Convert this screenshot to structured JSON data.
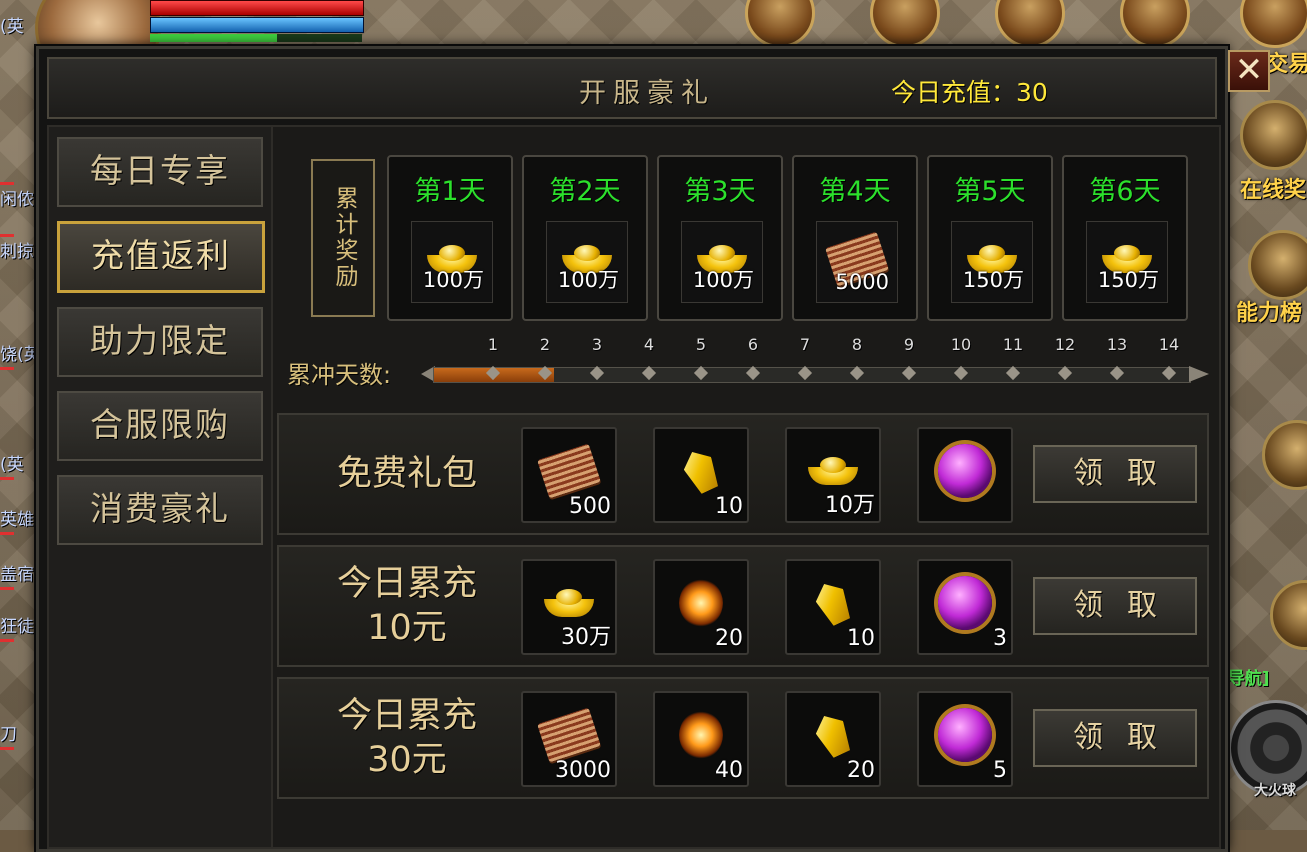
{
  "window": {
    "title": "开服豪礼",
    "recharge_today": "今日充值：30",
    "close_label": "✕"
  },
  "sidebar": {
    "tabs": [
      {
        "label": "每日专享",
        "active": false
      },
      {
        "label": "充值返利",
        "active": true
      },
      {
        "label": "助力限定",
        "active": false
      },
      {
        "label": "合服限购",
        "active": false
      },
      {
        "label": "消费豪礼",
        "active": false
      }
    ]
  },
  "cumulative": {
    "label": "累计奖励",
    "days": [
      {
        "title": "第1天",
        "item": "gold-ingot-icon",
        "qty": "100万"
      },
      {
        "title": "第2天",
        "item": "gold-ingot-icon",
        "qty": "100万"
      },
      {
        "title": "第3天",
        "item": "gold-ingot-icon",
        "qty": "100万"
      },
      {
        "title": "第4天",
        "item": "skill-book-icon",
        "qty": "5000"
      },
      {
        "title": "第5天",
        "item": "gold-ingot-icon",
        "qty": "150万"
      },
      {
        "title": "第6天",
        "item": "gold-ingot-icon",
        "qty": "150万"
      }
    ]
  },
  "progress": {
    "label": "累冲天数:",
    "ticks": [
      "1",
      "2",
      "3",
      "4",
      "5",
      "6",
      "7",
      "8",
      "9",
      "10",
      "11",
      "12",
      "13",
      "14"
    ],
    "current_day": 2,
    "total_days": 14
  },
  "rewards": [
    {
      "label_lines": [
        "免费礼包"
      ],
      "button": "领取",
      "items": [
        {
          "icon": "skill-book-icon",
          "qty": "500"
        },
        {
          "icon": "gold-crystal-icon",
          "qty": "10"
        },
        {
          "icon": "gold-ingot-icon",
          "qty": "10万"
        },
        {
          "icon": "purple-orb-icon",
          "qty": ""
        }
      ]
    },
    {
      "label_lines": [
        "今日累充",
        "10元"
      ],
      "button": "领取",
      "items": [
        {
          "icon": "gold-ingot-icon",
          "qty": "30万"
        },
        {
          "icon": "fire-stone-icon",
          "qty": "20"
        },
        {
          "icon": "gold-crystal-icon",
          "qty": "10"
        },
        {
          "icon": "purple-orb-icon",
          "qty": "3"
        }
      ]
    },
    {
      "label_lines": [
        "今日累充",
        "30元"
      ],
      "button": "领取",
      "items": [
        {
          "icon": "skill-book-icon",
          "qty": "3000"
        },
        {
          "icon": "fire-stone-icon",
          "qty": "40"
        },
        {
          "icon": "gold-crystal-icon",
          "qty": "20"
        },
        {
          "icon": "purple-orb-icon",
          "qty": "5"
        }
      ]
    }
  ],
  "background": {
    "left_tags": [
      "(英",
      "闲侬",
      "刺掠",
      "饶(英",
      "(英",
      "英雄",
      "盖宿",
      "狂徒",
      "刀"
    ],
    "right_texts": [
      "交易",
      "在线奖",
      "能力榜",
      "[导航]",
      "大火球"
    ]
  },
  "colors": {
    "day_title": "#2ce02c",
    "recharge": "#ffe83a",
    "accent_gold": "#c9a23c",
    "progress": "#c86a1c"
  }
}
